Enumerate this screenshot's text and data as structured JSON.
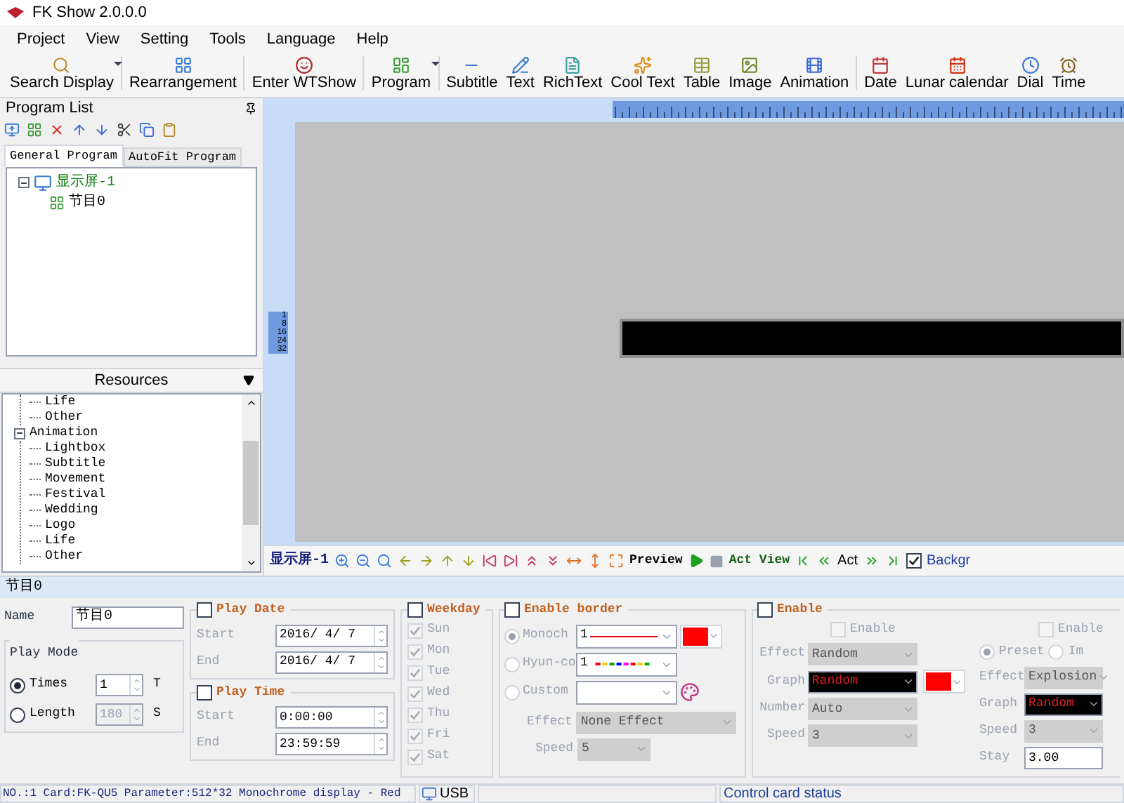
{
  "window": {
    "title": "FK Show 2.0.0.0"
  },
  "menu": [
    "Project",
    "View",
    "Setting",
    "Tools",
    "Language",
    "Help"
  ],
  "toolbar": [
    {
      "label": "Search Display",
      "dropdown": true,
      "separator_after": true
    },
    {
      "label": "Rearrangement",
      "dropdown": false,
      "separator_after": true
    },
    {
      "label": "Enter WTShow",
      "dropdown": false,
      "separator_after": true
    },
    {
      "label": "Program",
      "dropdown": true,
      "separator_after": true
    },
    {
      "label": "Subtitle",
      "dropdown": false,
      "separator_after": false
    },
    {
      "label": "Text",
      "dropdown": false,
      "separator_after": false
    },
    {
      "label": "RichText",
      "dropdown": false,
      "separator_after": false
    },
    {
      "label": "Cool Text",
      "dropdown": false,
      "separator_after": false
    },
    {
      "label": "Table",
      "dropdown": false,
      "separator_after": false
    },
    {
      "label": "Image",
      "dropdown": false,
      "separator_after": false
    },
    {
      "label": "Animation",
      "dropdown": false,
      "separator_after": true
    },
    {
      "label": "Date",
      "dropdown": false,
      "separator_after": false
    },
    {
      "label": "Lunar calendar",
      "dropdown": false,
      "separator_after": false
    },
    {
      "label": "Dial",
      "dropdown": false,
      "separator_after": false
    },
    {
      "label": "Time",
      "dropdown": false,
      "separator_after": false
    }
  ],
  "program_list": {
    "title": "Program List",
    "tabs": [
      {
        "label": "General Program",
        "selected": true
      },
      {
        "label": "AutoFit Program",
        "selected": false
      }
    ],
    "tree": [
      {
        "label": "显示屏-1",
        "expanded": true,
        "children": [
          {
            "label": "节目0"
          }
        ]
      }
    ]
  },
  "resources": {
    "title": "Resources",
    "continued_items": [
      "Life",
      "Other"
    ],
    "tree": [
      {
        "label": "Animation",
        "expanded": true,
        "children": [
          {
            "label": "Lightbox"
          },
          {
            "label": "Subtitle"
          },
          {
            "label": "Movement"
          },
          {
            "label": "Festival"
          },
          {
            "label": "Wedding"
          },
          {
            "label": "Logo"
          },
          {
            "label": "Life"
          },
          {
            "label": "Other"
          }
        ]
      }
    ]
  },
  "canvas": {
    "ruler_labels": [
      "1",
      "8",
      "16",
      "24",
      "32"
    ],
    "screen_tab": "显示屏-1",
    "preview": "Preview",
    "act_view": "Act View",
    "act": "Act",
    "background": {
      "label": "Backgr",
      "checked": true
    }
  },
  "program": {
    "title": "节目0",
    "name": {
      "label": "Name",
      "value": "节目0"
    },
    "play_mode": {
      "title": "Play Mode",
      "options": [
        {
          "label": "Times",
          "selected": true,
          "value": "1",
          "unit": "T",
          "disabled": false
        },
        {
          "label": "Length",
          "selected": false,
          "value": "180",
          "unit": "S",
          "disabled": true
        }
      ]
    },
    "play_date": {
      "label": "Play Date",
      "checked": false,
      "fields": [
        {
          "label": "Start",
          "value": "2016/ 4/ 7"
        },
        {
          "label": "End",
          "value": "2016/ 4/ 7"
        }
      ]
    },
    "play_time": {
      "label": "Play Time",
      "checked": false,
      "fields": [
        {
          "label": "Start",
          "value": "0:00:00"
        },
        {
          "label": "End",
          "value": "23:59:59"
        }
      ]
    },
    "weekday": {
      "label": "Weekday",
      "checked": false,
      "days": [
        {
          "label": "Sun",
          "checked": true
        },
        {
          "label": "Mon",
          "checked": true
        },
        {
          "label": "Tue",
          "checked": true
        },
        {
          "label": "Wed",
          "checked": true
        },
        {
          "label": "Thu",
          "checked": true
        },
        {
          "label": "Fri",
          "checked": true
        },
        {
          "label": "Sat",
          "checked": true
        }
      ]
    },
    "border": {
      "label": "Enable border",
      "checked": false,
      "color": "#ff0000",
      "modes": [
        {
          "label": "Monoch",
          "selected": true,
          "value": "1",
          "kind": "solid"
        },
        {
          "label": "Hyun-co",
          "selected": false,
          "value": "1",
          "kind": "rainbow"
        },
        {
          "label": "Custom",
          "selected": false,
          "kind": "custom"
        }
      ],
      "effect": {
        "label": "Effect",
        "value": "None Effect"
      },
      "speed": {
        "label": "Speed",
        "value": "5"
      }
    },
    "animation": {
      "label": "Enable",
      "checked": false,
      "entry": {
        "label": "Enable",
        "checked": false,
        "effect": {
          "label": "Effect",
          "value": "Random"
        },
        "graph": {
          "label": "Graph",
          "value": "Random"
        },
        "color": "#ff0000",
        "number": {
          "label": "Number",
          "value": "Auto"
        },
        "speed": {
          "label": "Speed",
          "value": "3"
        }
      },
      "exit": {
        "label": "Enable",
        "checked": false,
        "modes": [
          {
            "label": "Preset",
            "selected": true
          },
          {
            "label": "Im",
            "selected": false
          }
        ],
        "effect": {
          "label": "Effect",
          "value": "Explosion"
        },
        "graph": {
          "label": "Graph",
          "value": "Random"
        },
        "speed": {
          "label": "Speed",
          "value": "3"
        },
        "stay": {
          "label": "Stay",
          "value": "3.00"
        }
      }
    }
  },
  "status_bar": {
    "info": "NO.:1 Card:FK-QU5 Parameter:512*32 Monochrome display - Red",
    "connection": "USB",
    "card_status": "Control card status"
  }
}
